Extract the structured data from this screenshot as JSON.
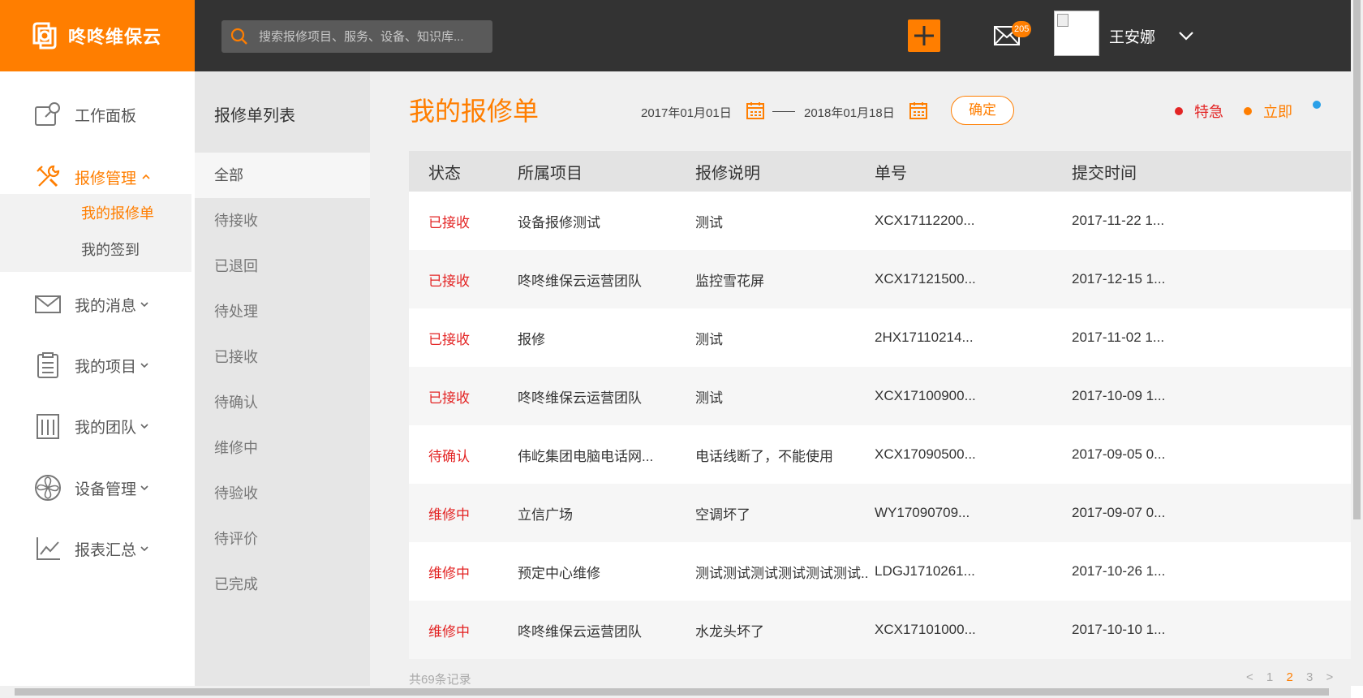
{
  "app": {
    "name": "咚咚维保云"
  },
  "search": {
    "placeholder": "搜索报修项目、服务、设备、知识库..."
  },
  "header": {
    "mail_count": "205",
    "username": "王安娜"
  },
  "leftnav": {
    "items": [
      {
        "label": "工作面板"
      },
      {
        "label": "报修管理"
      },
      {
        "label": "我的消息"
      },
      {
        "label": "我的项目"
      },
      {
        "label": "我的团队"
      },
      {
        "label": "设备管理"
      },
      {
        "label": "报表汇总"
      }
    ],
    "sub_items": [
      {
        "label": "我的报修单"
      },
      {
        "label": "我的签到"
      }
    ]
  },
  "midnav": {
    "title": "报修单列表",
    "items": [
      "全部",
      "待接收",
      "已退回",
      "待处理",
      "已接收",
      "待确认",
      "维修中",
      "待验收",
      "待评价",
      "已完成"
    ]
  },
  "main": {
    "title": "我的报修单",
    "date_from": "2017年01月01日",
    "date_to": "2018年01月18日",
    "confirm_label": "确定",
    "legend": [
      {
        "label": "特急",
        "color": "#e32424"
      },
      {
        "label": "立即",
        "color": "#ff7e00"
      },
      {
        "label": "",
        "color": "#2aa0e8"
      }
    ],
    "colors": {
      "accent": "#ff7e00",
      "status": "#e32424"
    },
    "table": {
      "headers": [
        "状态",
        "所属项目",
        "报修说明",
        "单号",
        "提交时间"
      ],
      "rows": [
        {
          "status": "已接收",
          "project": "设备报修测试",
          "desc": "测试",
          "no": "XCX17112200...",
          "time": "2017-11-22 1..."
        },
        {
          "status": "已接收",
          "project": "咚咚维保云运营团队",
          "desc": "监控雪花屏",
          "no": "XCX17121500...",
          "time": "2017-12-15 1..."
        },
        {
          "status": "已接收",
          "project": "报修",
          "desc": "测试",
          "no": "2HX17110214...",
          "time": "2017-11-02 1..."
        },
        {
          "status": "已接收",
          "project": "咚咚维保云运营团队",
          "desc": "测试",
          "no": "XCX17100900...",
          "time": "2017-10-09 1..."
        },
        {
          "status": "待确认",
          "project": "伟屹集团电脑电话网...",
          "desc": "电话线断了，不能使用",
          "no": "XCX17090500...",
          "time": "2017-09-05 0..."
        },
        {
          "status": "维修中",
          "project": "立信广场",
          "desc": "空调坏了",
          "no": "WY17090709...",
          "time": "2017-09-07 0..."
        },
        {
          "status": "维修中",
          "project": "预定中心维修",
          "desc": "测试测试测试测试测试测试...",
          "no": "LDGJ1710261...",
          "time": "2017-10-26 1..."
        },
        {
          "status": "维修中",
          "project": "咚咚维保云运营团队",
          "desc": "水龙头坏了",
          "no": "XCX17101000...",
          "time": "2017-10-10 1..."
        }
      ]
    },
    "footer_text": "共69条记录",
    "pager": {
      "prev": "< 1",
      "pages": [
        "2",
        "3"
      ],
      "current": "2",
      "next": ">"
    }
  }
}
